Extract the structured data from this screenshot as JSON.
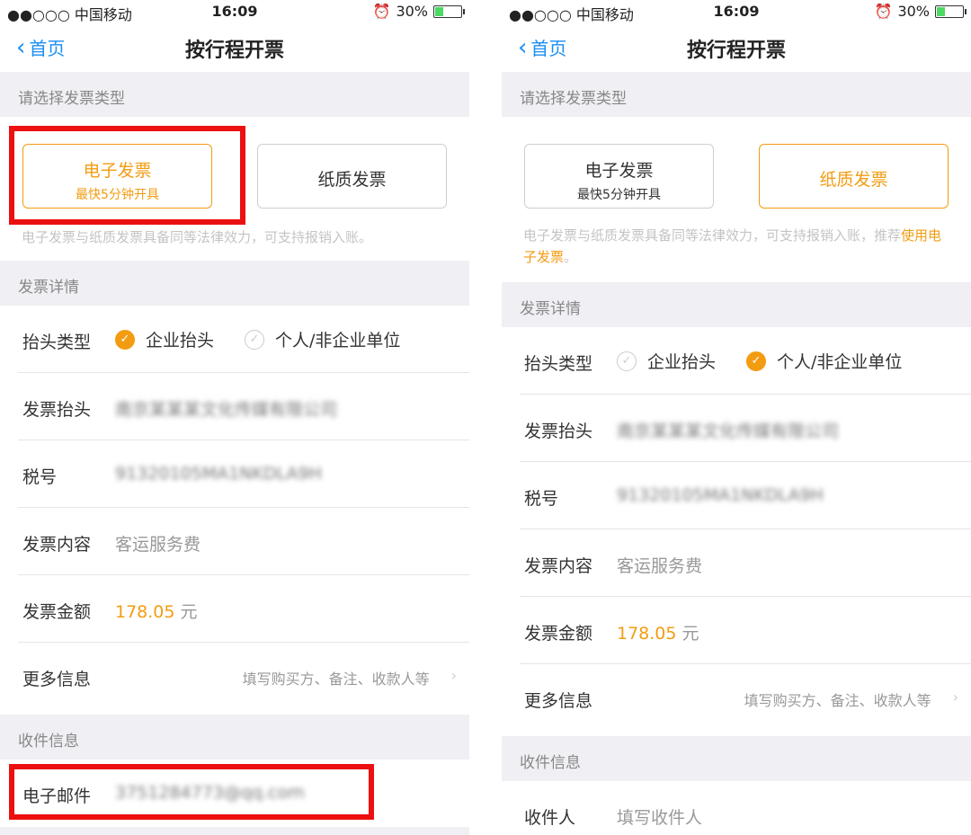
{
  "status": {
    "carrier": "●●○○○ 中国移动",
    "time": "16:09",
    "battery": "30%",
    "battery_level": 0.3
  },
  "nav": {
    "back_label": "首页",
    "title": "按行程开票"
  },
  "sections": {
    "invoice_type": "请选择发票类型",
    "invoice_details": "发票详情",
    "delivery_info": "收件信息"
  },
  "invoice_options": {
    "electronic": {
      "title": "电子发票",
      "subtitle": "最快5分钟开具"
    },
    "paper": {
      "title": "纸质发票"
    }
  },
  "notes": {
    "left": "电子发票与纸质发票具备同等法律效力，可支持报销入账。",
    "right_prefix": "电子发票与纸质发票具备同等法律效力，可支持报销入账，推荐",
    "right_highlight": "使用电子发票",
    "right_suffix": "。"
  },
  "fields": {
    "header_type_label": "抬头类型",
    "header_enterprise": "企业抬头",
    "header_personal": "个人/非企业单位",
    "header_label": "发票抬头",
    "header_value": "南京某某某文化传媒有限公司",
    "tax_label": "税号",
    "tax_value": "91320105MA1NKDLA9H",
    "content_label": "发票内容",
    "content_value": "客运服务费",
    "amount_label": "发票金额",
    "amount_value": "178.05",
    "amount_unit": "元",
    "more_label": "更多信息",
    "more_hint": "填写购买方、备注、收款人等"
  },
  "delivery": {
    "email_label": "电子邮件",
    "email_value": "3751284773@qq.com",
    "recipient_label": "收件人",
    "recipient_placeholder": "填写收件人"
  },
  "colors": {
    "accent": "#f39c12",
    "link": "#1a8ef2",
    "highlight_box": "#ec1010"
  }
}
